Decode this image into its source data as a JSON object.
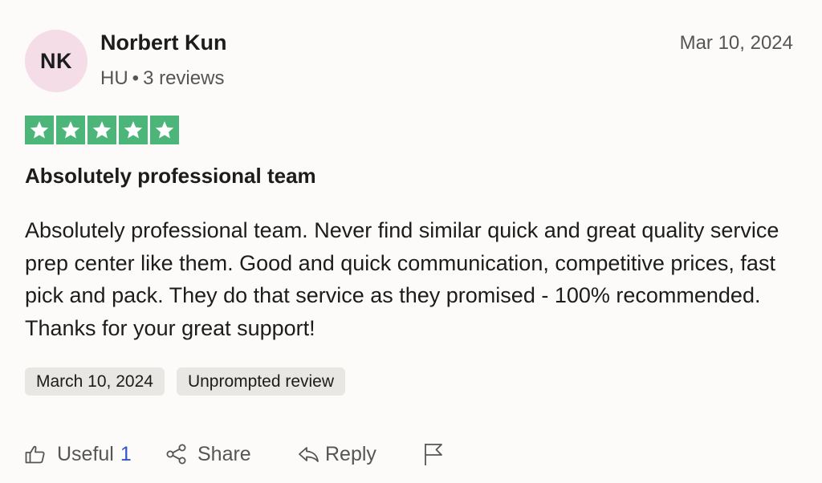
{
  "author": {
    "initials": "NK",
    "name": "Norbert Kun",
    "country": "HU",
    "separator": "•",
    "reviews": "3 reviews"
  },
  "date": "Mar 10, 2024",
  "rating": {
    "stars": 5,
    "max": 5,
    "color": "#4cb579"
  },
  "review": {
    "title": "Absolutely professional team",
    "body": "Absolutely professional team. Never find similar quick and great quality service prep center like them. Good and quick communication, competitive prices, fast pick and pack. They do that service as they promised - 100% recommended. Thanks for your great support!"
  },
  "tags": {
    "experience_date": "March 10, 2024",
    "review_type": "Unprompted review"
  },
  "actions": {
    "useful_label": "Useful",
    "useful_count": "1",
    "share_label": "Share",
    "reply_label": "Reply"
  },
  "icons": {
    "useful": "thumbs-up-icon",
    "share": "share-icon",
    "reply": "reply-icon",
    "report": "flag-icon",
    "star": "star-icon"
  },
  "colors": {
    "avatar_bg": "#f4dde7",
    "star_green": "#4cb579",
    "tag_bg": "#e9e7e4",
    "count_blue": "#2f57c9"
  }
}
